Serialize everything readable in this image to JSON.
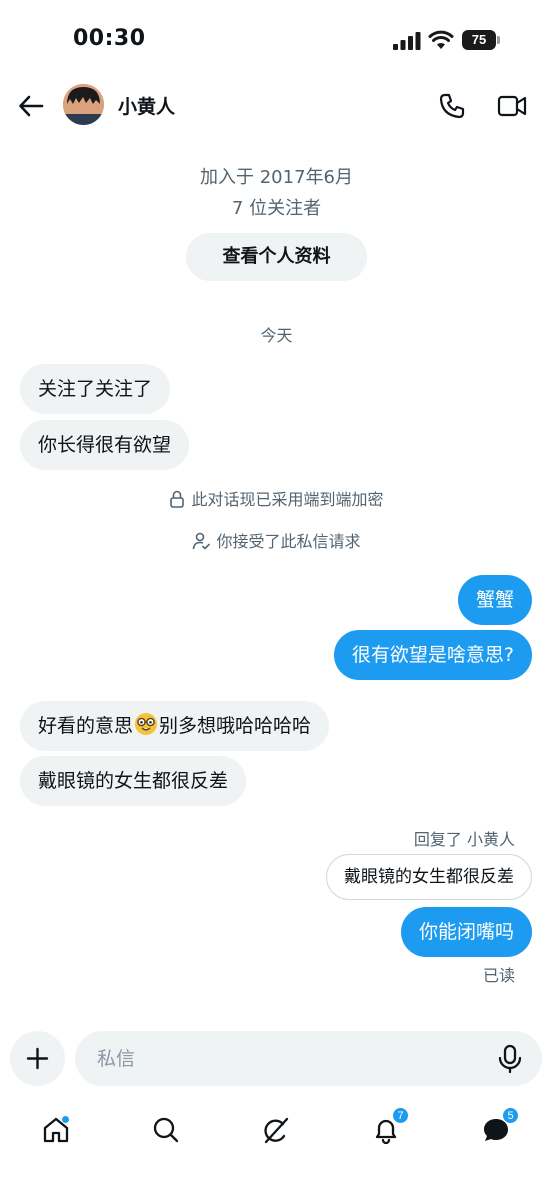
{
  "status_bar": {
    "time": "00:30",
    "battery": "75"
  },
  "header": {
    "contact_name": "小黄人"
  },
  "profile": {
    "joined": "加入于 2017年6月",
    "followers": "7 位关注者",
    "view_profile_label": "查看个人资料"
  },
  "date_divider": "今天",
  "messages": [
    {
      "side": "in",
      "text": "关注了关注了"
    },
    {
      "side": "in",
      "text": "你长得很有欲望"
    },
    {
      "side": "out",
      "text": "蟹蟹"
    },
    {
      "side": "out",
      "text": "很有欲望是啥意思?"
    },
    {
      "side": "in",
      "text_before": "好看的意思",
      "emoji": "nerd-face-emoji",
      "text_after": "别多想哦哈哈哈哈"
    },
    {
      "side": "in",
      "text": "戴眼镜的女生都很反差"
    },
    {
      "side": "out",
      "text": "你能闭嘴吗"
    }
  ],
  "system_notices": {
    "encryption": "此对话现已采用端到端加密",
    "accepted": "你接受了此私信请求"
  },
  "reply": {
    "label": "回复了 小黄人",
    "quoted_text": "戴眼镜的女生都很反差"
  },
  "read_receipt": "已读",
  "composer": {
    "placeholder": "私信"
  },
  "bottom_nav": {
    "notifications_badge": "7",
    "messages_badge": "5"
  },
  "colors": {
    "accent": "#1d9bf0",
    "bubble_in": "#eff3f4",
    "secondary_text": "#536471"
  },
  "icons": [
    "back-arrow-icon",
    "phone-icon",
    "video-camera-icon",
    "lock-icon",
    "person-check-icon",
    "plus-icon",
    "microphone-icon",
    "home-icon",
    "search-icon",
    "grok-icon",
    "bell-icon",
    "messages-icon"
  ]
}
